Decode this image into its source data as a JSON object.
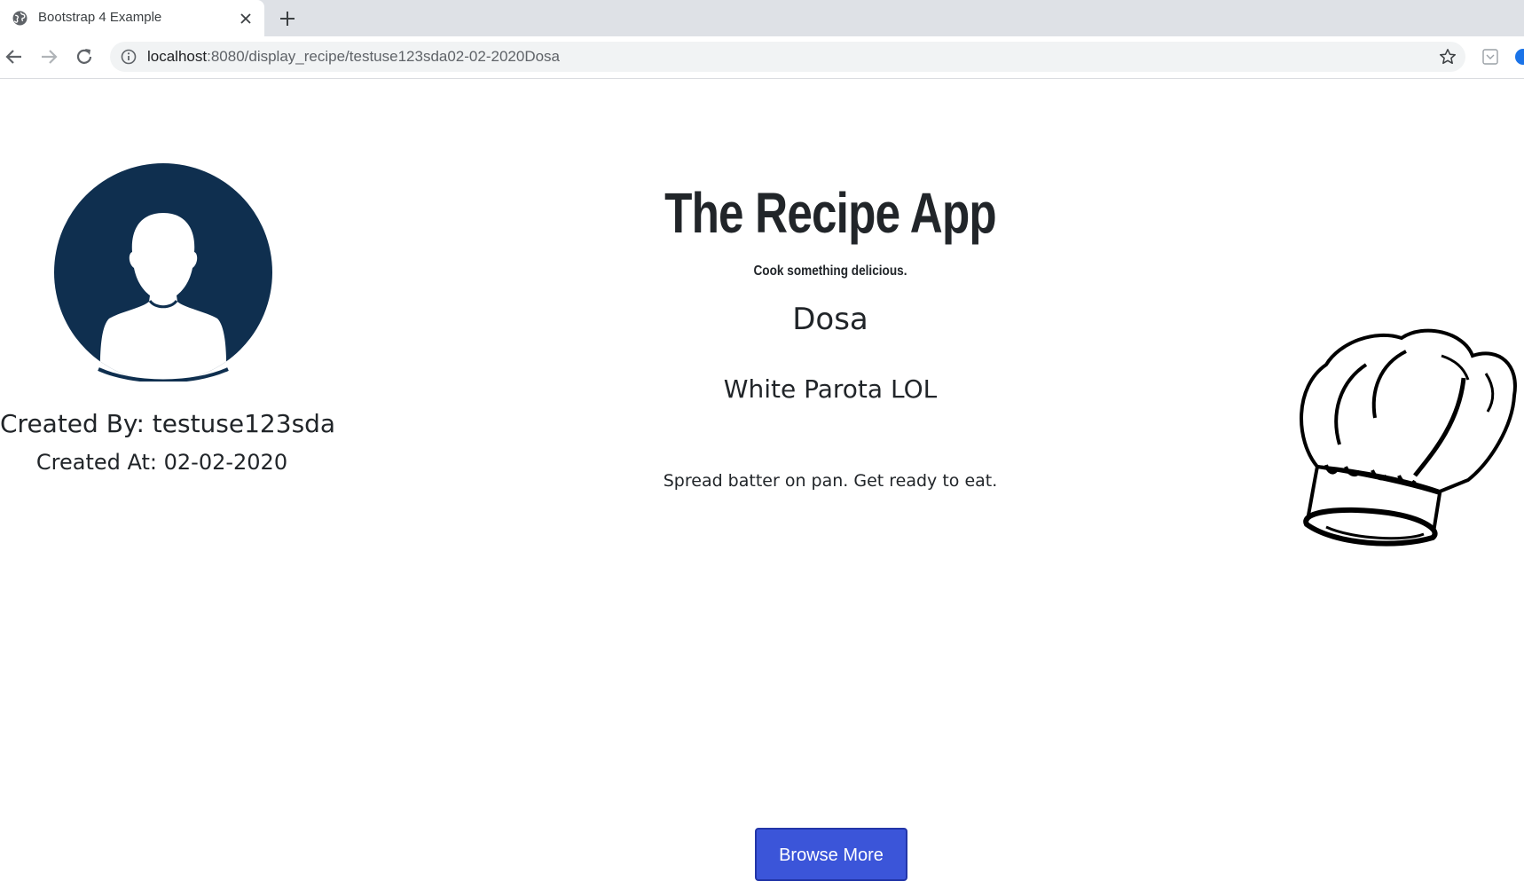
{
  "browser": {
    "tab_title": "Bootstrap 4 Example",
    "url_host": "localhost",
    "url_rest": ":8080/display_recipe/testuse123sda02-02-2020Dosa",
    "icons": {
      "favicon": "globe-icon",
      "tab_close": "close-icon",
      "new_tab": "plus-icon",
      "back": "back-arrow-icon",
      "forward": "forward-arrow-icon",
      "reload": "reload-icon",
      "site_info": "info-icon",
      "bookmark": "star-icon",
      "extension": "extension-icon",
      "profile": "profile-icon"
    }
  },
  "author": {
    "created_by": "Created By: testuse123sda",
    "created_at": "Created At: 02-02-2020",
    "avatar_icon": "user-avatar-icon",
    "avatar_color": "#0f2f4f"
  },
  "header": {
    "title": "The Recipe App",
    "tagline": "Cook something delicious."
  },
  "recipe": {
    "name": "Dosa",
    "description": "White Parota LOL",
    "steps": "Spread batter on pan. Get ready to eat."
  },
  "decoration": {
    "chef_hat_icon": "chef-hat-icon"
  },
  "actions": {
    "browse_label": "Browse More",
    "button_color": "#3b55d9"
  }
}
